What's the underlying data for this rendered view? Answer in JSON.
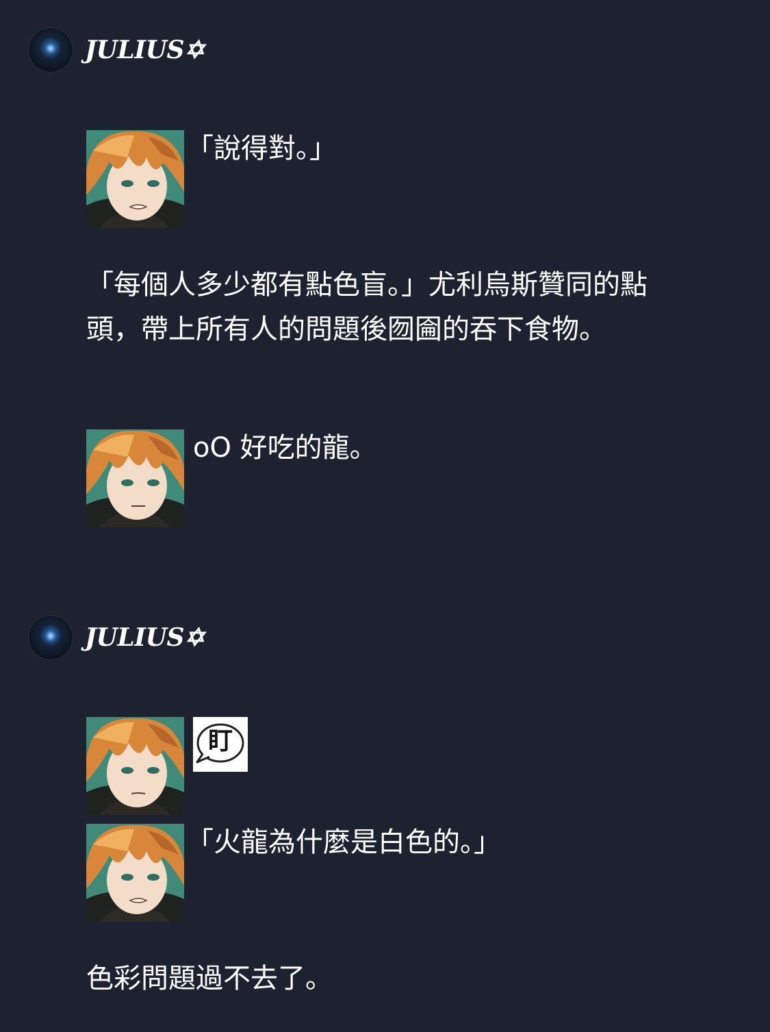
{
  "posts": [
    {
      "username": "JULIUS✡",
      "lines": [
        "「說得對。」",
        "「每個人多少都有點色盲。」尤利烏斯贊同的點",
        "頭，帶上所有人的問題後囫圇的吞下食物。",
        "oO 好吃的龍。"
      ]
    },
    {
      "username": "JULIUS✡",
      "sticker_text": "盯",
      "lines": [
        "「火龍為什麼是白色的。」",
        "色彩問題過不去了。"
      ]
    }
  ],
  "colors": {
    "background": "#1e2230",
    "text": "#ffffff"
  },
  "icons": {
    "avatar": "nebula-avatar-icon",
    "portrait": "character-portrait-icon",
    "sticker": "speech-bubble-stare-icon"
  }
}
